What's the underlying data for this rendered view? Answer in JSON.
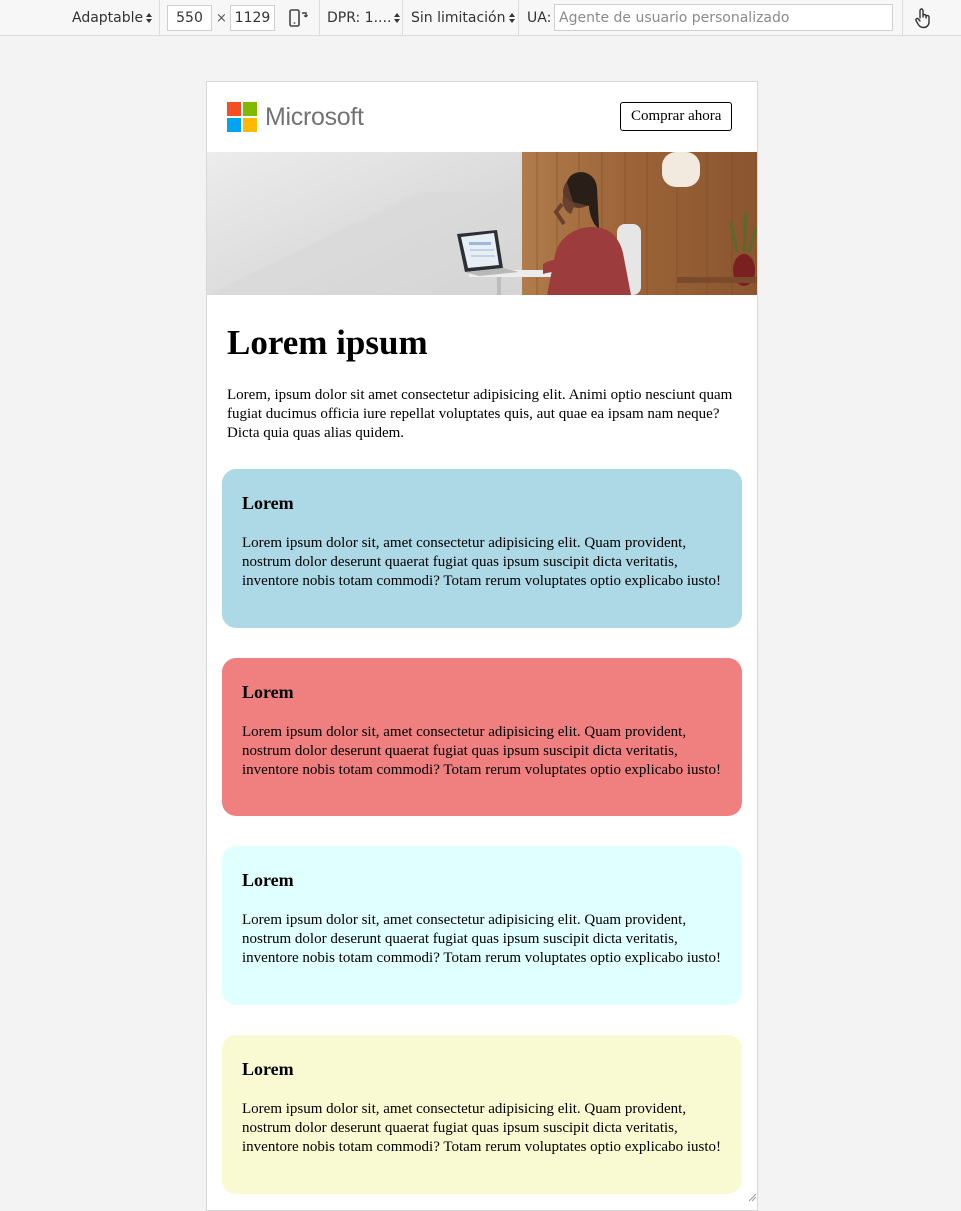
{
  "devtools": {
    "device_mode": "Adaptable",
    "width": "550",
    "times": "×",
    "height": "1129",
    "dpr": "DPR: 1....",
    "throttling": "Sin limitación",
    "ua_label": "UA:",
    "ua_placeholder": "Agente de usuario personalizado"
  },
  "header": {
    "logo_text": "Microsoft",
    "logo_colors": [
      "#f25022",
      "#7fba00",
      "#00a4ef",
      "#ffb900"
    ],
    "cta_label": "Comprar ahora"
  },
  "main": {
    "title": "Lorem ipsum",
    "intro": "Lorem, ipsum dolor sit amet consectetur adipisicing elit. Animi optio nesciunt quam fugiat ducimus officia iure repellat voluptates quis, aut quae ea ipsam nam neque? Dicta quia quas alias quidem."
  },
  "cards": [
    {
      "title": "Lorem",
      "text": "Lorem ipsum dolor sit, amet consectetur adipisicing elit. Quam provident, nostrum dolor deserunt quaerat fugiat quas ipsum suscipit dicta veritatis, inventore nobis totam commodi? Totam rerum voluptates optio explicabo iusto!",
      "color": "#add8e6"
    },
    {
      "title": "Lorem",
      "text": "Lorem ipsum dolor sit, amet consectetur adipisicing elit. Quam provident, nostrum dolor deserunt quaerat fugiat quas ipsum suscipit dicta veritatis, inventore nobis totam commodi? Totam rerum voluptates optio explicabo iusto!",
      "color": "#f08080"
    },
    {
      "title": "Lorem",
      "text": "Lorem ipsum dolor sit, amet consectetur adipisicing elit. Quam provident, nostrum dolor deserunt quaerat fugiat quas ipsum suscipit dicta veritatis, inventore nobis totam commodi? Totam rerum voluptates optio explicabo iusto!",
      "color": "#e0ffff"
    },
    {
      "title": "Lorem",
      "text": "Lorem ipsum dolor sit, amet consectetur adipisicing elit. Quam provident, nostrum dolor deserunt quaerat fugiat quas ipsum suscipit dicta veritatis, inventore nobis totam commodi? Totam rerum voluptates optio explicabo iusto!",
      "color": "#fafad2"
    }
  ]
}
